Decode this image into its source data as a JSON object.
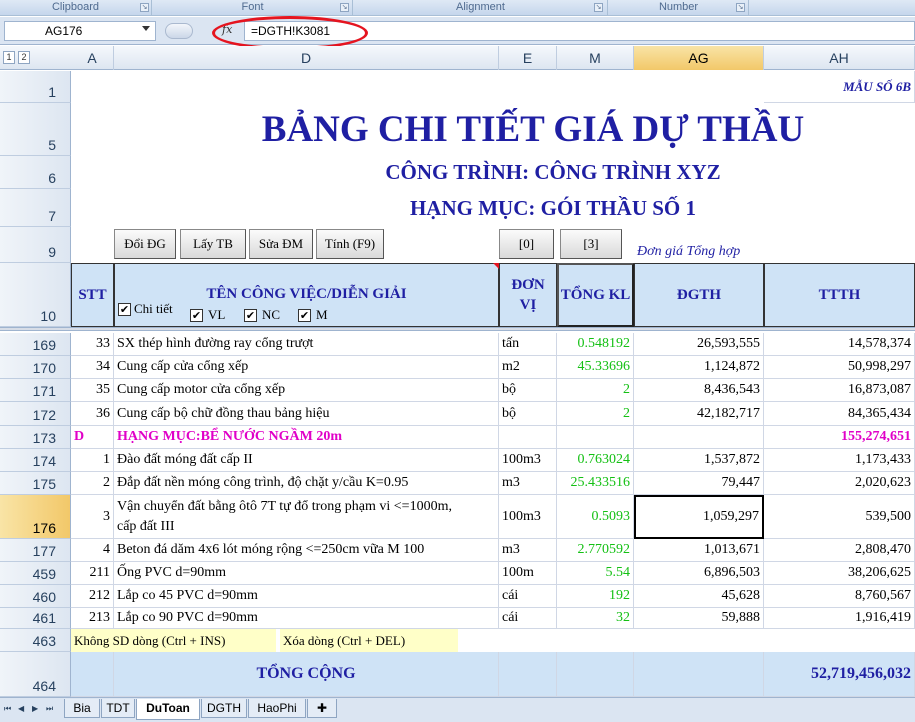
{
  "ribbon": {
    "groups": [
      "Clipboard",
      "Font",
      "Alignment",
      "Number"
    ]
  },
  "name_box": "AG176",
  "formula_icon": "fx-icon",
  "formula": "=DGTH!K3081",
  "outline_levels": [
    "1",
    "2"
  ],
  "columns": [
    "A",
    "D",
    "E",
    "M",
    "AG",
    "AH"
  ],
  "header": {
    "form_code": "MẪU SỐ 6B",
    "title": "BẢNG CHI TIẾT GIÁ DỰ THẦU",
    "project": "CÔNG TRÌNH: CÔNG TRÌNH XYZ",
    "item": "HẠNG MỤC: GÓI THẦU SỐ 1",
    "buttons": [
      "Đổi ĐG",
      "Lấy TB",
      "Sửa ĐM",
      "Tính (F9)"
    ],
    "btn_0": "[0]",
    "btn_3": "[3]",
    "unit_price_note": "Đơn giá Tổng hợp"
  },
  "table_headers": {
    "stt": "STT",
    "desc": "TÊN CÔNG VIỆC/DIỄN GIẢI",
    "unit": "ĐƠN VỊ",
    "qty": "TỔNG KL",
    "dgth": "ĐGTH",
    "ttth": "TTTH",
    "checkboxes": [
      "Chi tiết",
      "VL",
      "NC",
      "M"
    ]
  },
  "row_numbers": {
    "r1": "1",
    "r5": "5",
    "r6": "6",
    "r7": "7",
    "r9": "9",
    "r10": "10"
  },
  "rows": [
    {
      "n": "169",
      "stt": "33",
      "desc": "SX thép hình đường ray cổng trượt",
      "unit": "tấn",
      "qty": "0.548192",
      "dgth": "26,593,555",
      "ttth": "14,578,374"
    },
    {
      "n": "170",
      "stt": "34",
      "desc": "Cung cấp cửa cổng xếp",
      "unit": "m2",
      "qty": "45.33696",
      "dgth": "1,124,872",
      "ttth": "50,998,297"
    },
    {
      "n": "171",
      "stt": "35",
      "desc": "Cung cấp motor cửa cổng xếp",
      "unit": "bộ",
      "qty": "2",
      "dgth": "8,436,543",
      "ttth": "16,873,087"
    },
    {
      "n": "172",
      "stt": "36",
      "desc": "Cung cấp bộ chữ đồng thau bảng hiệu",
      "unit": "bộ",
      "qty": "2",
      "dgth": "42,182,717",
      "ttth": "84,365,434"
    },
    {
      "n": "173",
      "stt": "D",
      "desc": "HẠNG MỤC:BỂ NƯỚC NGẦM 20m",
      "unit": "",
      "qty": "",
      "dgth": "",
      "ttth": "155,274,651"
    },
    {
      "n": "174",
      "stt": "1",
      "desc": "Đào đất móng đất cấp II",
      "unit": "100m3",
      "qty": "0.763024",
      "dgth": "1,537,872",
      "ttth": "1,173,433"
    },
    {
      "n": "175",
      "stt": "2",
      "desc": "Đắp đất nền móng công trình, độ chặt y/cầu K=0.95",
      "unit": "m3",
      "qty": "25.433516",
      "dgth": "79,447",
      "ttth": "2,020,623"
    },
    {
      "n": "176",
      "stt": "3",
      "desc": "Vận chuyển đất bằng ôtô 7T tự đổ trong phạm vi <=1000m,",
      "desc2": "cấp đất III",
      "unit": "100m3",
      "qty": "0.5093",
      "dgth": "1,059,297",
      "ttth": "539,500"
    },
    {
      "n": "177",
      "stt": "4",
      "desc": "Beton đá dăm 4x6 lót móng rộng <=250cm vữa M 100",
      "unit": "m3",
      "qty": "2.770592",
      "dgth": "1,013,671",
      "ttth": "2,808,470"
    },
    {
      "n": "459",
      "stt": "211",
      "desc": "Ống PVC d=90mm",
      "unit": "100m",
      "qty": "5.54",
      "dgth": "6,896,503",
      "ttth": "38,206,625"
    },
    {
      "n": "460",
      "stt": "212",
      "desc": "Lắp co 45 PVC d=90mm",
      "unit": "cái",
      "qty": "192",
      "dgth": "45,628",
      "ttth": "8,760,567"
    },
    {
      "n": "461",
      "stt": "213",
      "desc": "Lắp co 90 PVC d=90mm",
      "unit": "cái",
      "qty": "32",
      "dgth": "59,888",
      "ttth": "1,916,419"
    }
  ],
  "row463": {
    "n": "463",
    "note1": "Không SD    dòng (Ctrl + INS)",
    "note2": "Xóa dòng (Ctrl + DEL)"
  },
  "row464": {
    "n": "464",
    "label": "TỔNG CỘNG",
    "total": "52,719,456,032"
  },
  "sheet_tabs": [
    "Bia",
    "TDT",
    "DuToan",
    "DGTH",
    "HaoPhi"
  ],
  "active_tab": "DuToan",
  "colors": {
    "accent_blue": "#1f1fa3",
    "qty_green": "#13c013",
    "section_magenta": "#e000c8",
    "header_fill": "#cfe3f6",
    "highlight_red": "#e5141f"
  }
}
